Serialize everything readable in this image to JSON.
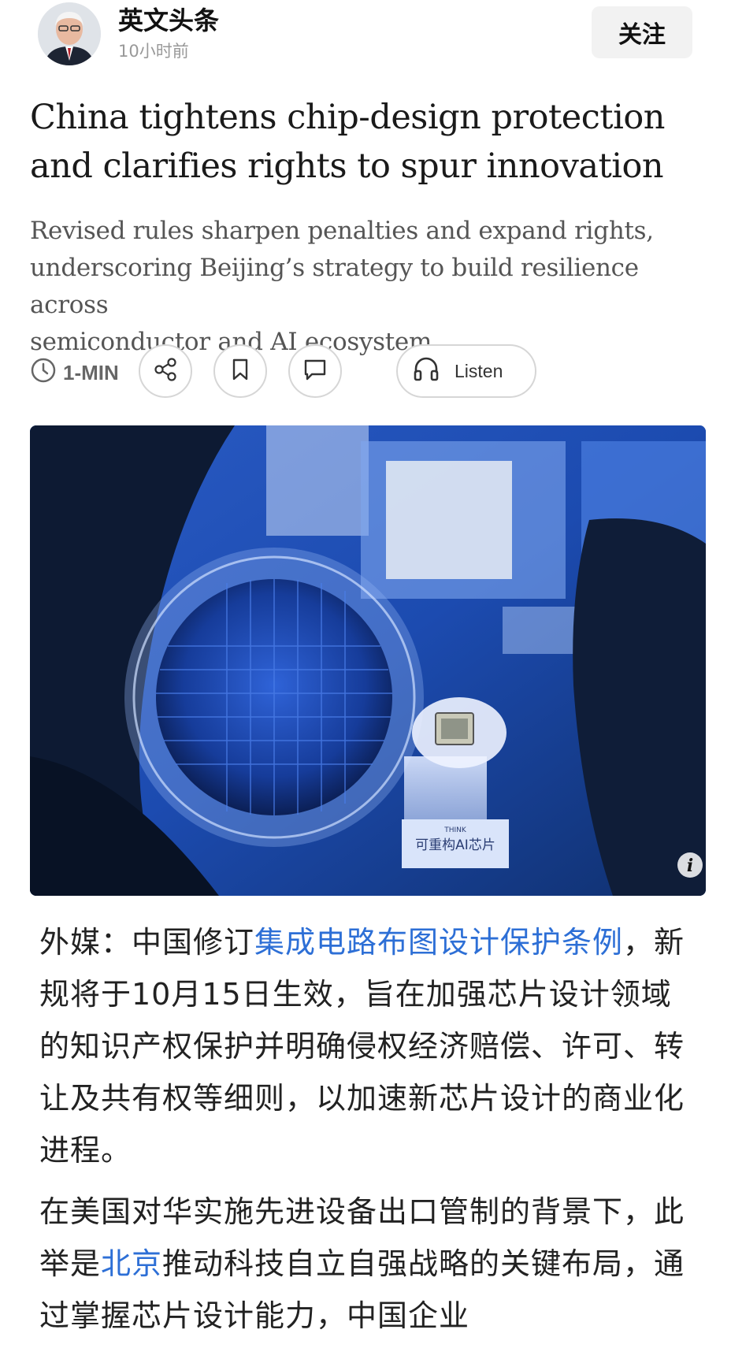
{
  "header": {
    "author_name": "英文头条",
    "post_time": "10小时前",
    "follow_label": "关注"
  },
  "article": {
    "headline": "China tightens chip-design protection and clarifies rights to spur innovation",
    "subhead": "Revised rules sharpen penalties and expand rights,\nunderscoring Beijing’s strategy to build resilience across\nsemiconductor and AI ecosystem",
    "read_time": "1-MIN",
    "listen_label": "Listen",
    "image": {
      "stand_label": "可重构AI芯片",
      "stand_sublabel": "THINK",
      "info_badge": "i"
    }
  },
  "body": {
    "p1_before": "外媒：中国修订",
    "p1_link": "集成电路布图设计保护条例",
    "p1_after": "，新规将于10月15日生效，旨在加强芯片设计领域的知识产权保护并明确侵权经济赔偿、许可、转让及共有权等细则，以加速新芯片设计的商业化进程。",
    "p2_before": "在美国对华实施先进设备出口管制的背景下，此举是",
    "p2_link": "北京",
    "p2_after": "推动科技自立自强战略的关键布局，通过掌握芯片设计能力，中国企业"
  },
  "colors": {
    "link": "#2d6fd6",
    "follow_bg": "#f2f2f2",
    "muted": "#999999"
  },
  "icons": [
    "clock-icon",
    "share-icon",
    "bookmark-icon",
    "comment-icon",
    "headphones-icon",
    "info-icon"
  ]
}
